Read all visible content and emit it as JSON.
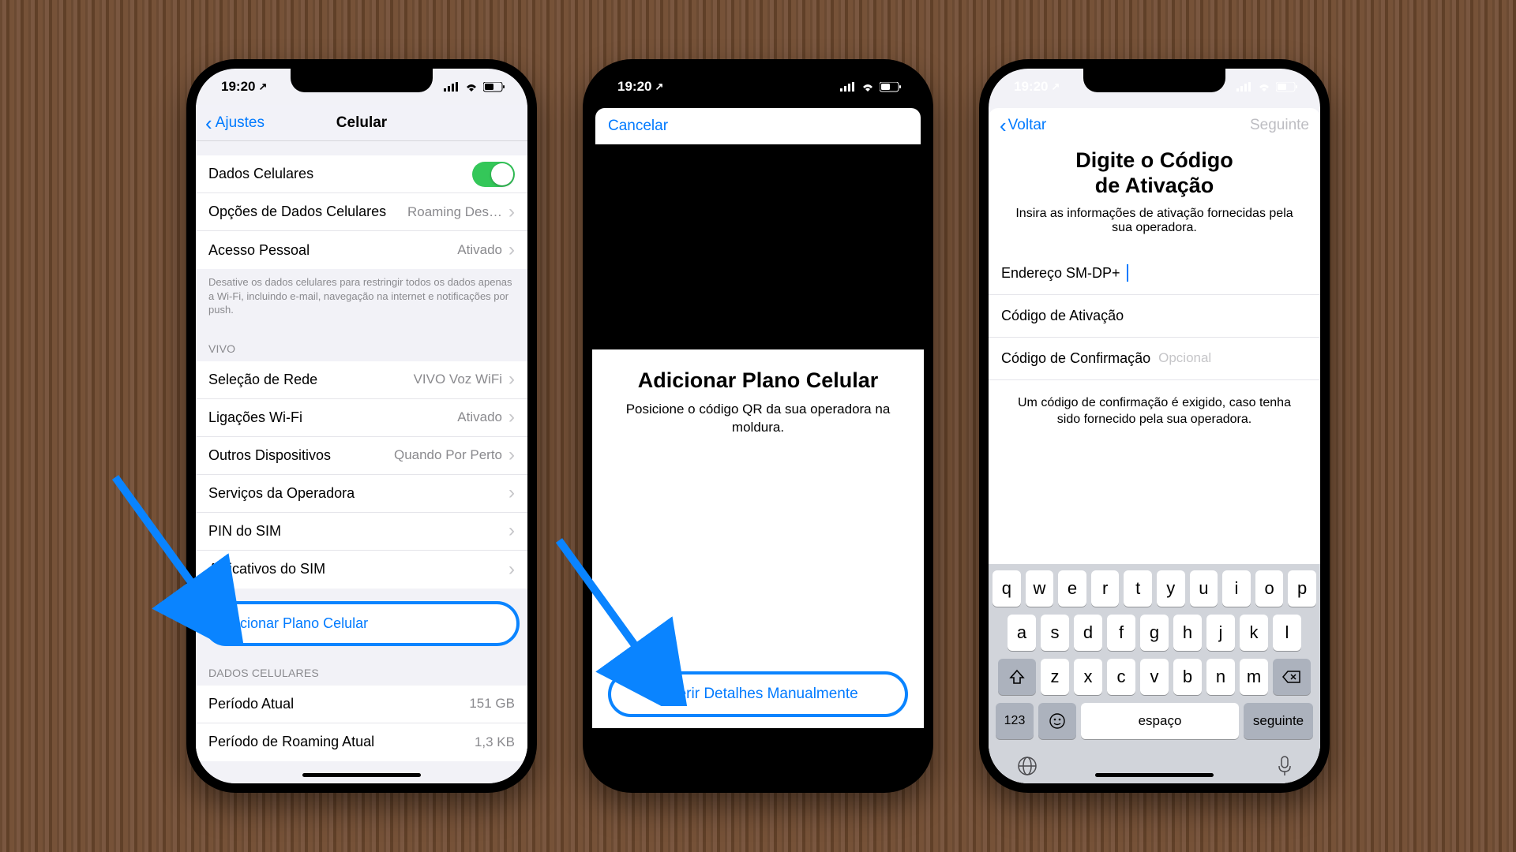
{
  "status": {
    "time": "19:20",
    "loc_arrow": "➤"
  },
  "p1": {
    "back": "Ajustes",
    "title": "Celular",
    "row_data": "Dados Celulares",
    "row_options": "Opções de Dados Celulares",
    "row_options_val": "Roaming Des…",
    "row_hotspot": "Acesso Pessoal",
    "row_hotspot_val": "Ativado",
    "footnote": "Desative os dados celulares para restringir todos os dados apenas a Wi-Fi, incluindo e-mail, navegação na internet e notificações por push.",
    "carrier_header": "VIVO",
    "row_net": "Seleção de Rede",
    "row_net_val": "VIVO Voz WiFi",
    "row_wifi": "Ligações Wi-Fi",
    "row_wifi_val": "Ativado",
    "row_other": "Outros Dispositivos",
    "row_other_val": "Quando Por Perto",
    "row_carrier_svc": "Serviços da Operadora",
    "row_sim_pin": "PIN do SIM",
    "row_sim_apps": "Aplicativos do SIM",
    "add_plan": "Adicionar Plano Celular",
    "data_header": "DADOS CELULARES",
    "row_period": "Período Atual",
    "row_period_val": "151 GB",
    "row_roaming": "Período de Roaming Atual",
    "row_roaming_val": "1,3 KB"
  },
  "p2": {
    "cancel": "Cancelar",
    "title": "Adicionar Plano Celular",
    "subtitle": "Posicione o código QR da sua operadora na moldura.",
    "manual": "Inserir Detalhes Manualmente"
  },
  "p3": {
    "back": "Voltar",
    "next": "Seguinte",
    "title_l1": "Digite o Código",
    "title_l2": "de Ativação",
    "subtitle": "Insira as informações de ativação fornecidas pela sua operadora.",
    "f1": "Endereço SM-DP+",
    "f2": "Código de Ativação",
    "f3": "Código de Confirmação",
    "f3_ph": "Opcional",
    "note": "Um código de confirmação é exigido, caso tenha sido fornecido pela sua operadora.",
    "kb": {
      "r1": [
        "q",
        "w",
        "e",
        "r",
        "t",
        "y",
        "u",
        "i",
        "o",
        "p"
      ],
      "r2": [
        "a",
        "s",
        "d",
        "f",
        "g",
        "h",
        "j",
        "k",
        "l"
      ],
      "r3": [
        "z",
        "x",
        "c",
        "v",
        "b",
        "n",
        "m"
      ],
      "num": "123",
      "space": "espaço",
      "go": "seguinte"
    }
  }
}
